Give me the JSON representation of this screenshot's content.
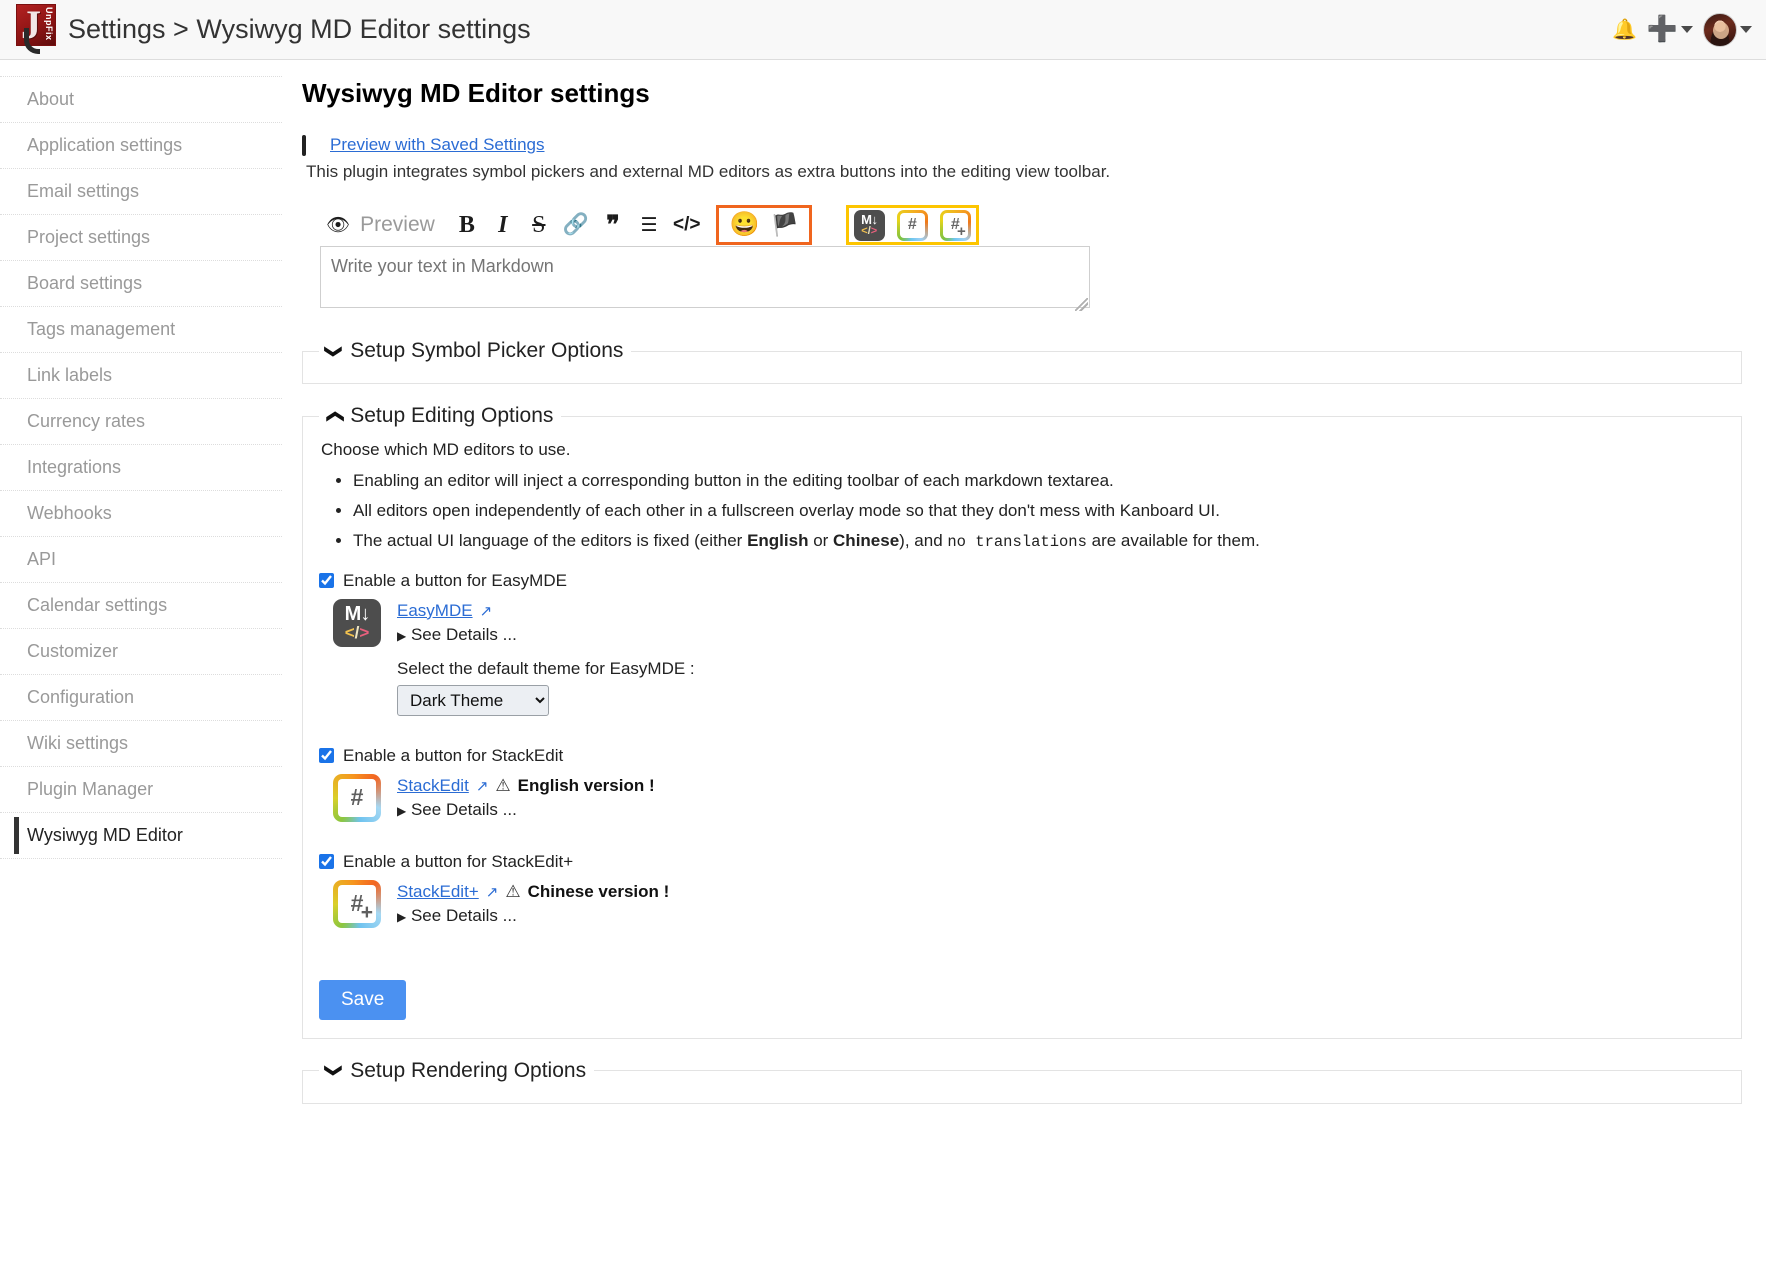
{
  "header": {
    "title": "Settings > Wysiwyg MD Editor settings",
    "logo_text": "UnpFix",
    "notifications_icon": "bell-icon",
    "add_icon": "plus-icon",
    "user_menu_caret": "chevron-down-icon"
  },
  "sidebar": {
    "items": [
      {
        "label": "About",
        "active": false
      },
      {
        "label": "Application settings",
        "active": false
      },
      {
        "label": "Email settings",
        "active": false
      },
      {
        "label": "Project settings",
        "active": false
      },
      {
        "label": "Board settings",
        "active": false
      },
      {
        "label": "Tags management",
        "active": false
      },
      {
        "label": "Link labels",
        "active": false
      },
      {
        "label": "Currency rates",
        "active": false
      },
      {
        "label": "Integrations",
        "active": false
      },
      {
        "label": "Webhooks",
        "active": false
      },
      {
        "label": "API",
        "active": false
      },
      {
        "label": "Calendar settings",
        "active": false
      },
      {
        "label": "Customizer",
        "active": false
      },
      {
        "label": "Configuration",
        "active": false
      },
      {
        "label": "Wiki settings",
        "active": false
      },
      {
        "label": "Plugin Manager",
        "active": false
      },
      {
        "label": "Wysiwyg MD Editor",
        "active": true
      }
    ]
  },
  "main": {
    "title": "Wysiwyg MD Editor settings",
    "preview_link": "Preview with Saved Settings",
    "intro": "This plugin integrates symbol pickers and external MD editors as extra buttons into the editing view toolbar.",
    "demo": {
      "preview_label": "Preview",
      "bold": "B",
      "italic": "I",
      "strike": "S",
      "link": "🔗",
      "quote": "❞",
      "list": "☰",
      "code": "</>",
      "emoji": "😀",
      "flag": "🏴",
      "easymde_top": "M",
      "easymde_arrow": "↓",
      "stackedit_glyph": "#",
      "stackeditplus_glyph": "#",
      "stackeditplus_plus": "+",
      "textarea_placeholder": "Write your text in Markdown",
      "textarea_value": "",
      "highlight_symbol_color": "#f0651e",
      "highlight_editor_color": "#fdc500"
    },
    "panels": {
      "symbol_picker": {
        "title": "Setup Symbol Picker Options",
        "collapsed": true,
        "chevron": "chevron-down-icon"
      },
      "editing": {
        "title": "Setup Editing Options",
        "collapsed": false,
        "chevron": "chevron-up-icon"
      },
      "rendering": {
        "title": "Setup Rendering Options",
        "collapsed": true,
        "chevron": "chevron-down-icon"
      }
    },
    "editing": {
      "choose_text": "Choose which MD editors to use.",
      "notes": [
        {
          "parts": [
            {
              "t": "Enabling an editor will inject a corresponding button in the editing toolbar of each markdown textarea.",
              "s": "n"
            }
          ]
        },
        {
          "parts": [
            {
              "t": "All editors open independently of each other in a fullscreen overlay mode so that they don't mess with Kanboard UI.",
              "s": "n"
            }
          ]
        },
        {
          "parts": [
            {
              "t": "The actual UI language of the editors is fixed (either ",
              "s": "n"
            },
            {
              "t": "English",
              "s": "b"
            },
            {
              "t": " or ",
              "s": "n"
            },
            {
              "t": "Chinese",
              "s": "b"
            },
            {
              "t": "), and ",
              "s": "n"
            },
            {
              "t": "no translations",
              "s": "m"
            },
            {
              "t": " are available for them.",
              "s": "n"
            }
          ]
        }
      ],
      "editors": [
        {
          "enable_label": "Enable a button for EasyMDE",
          "checked": true,
          "name": "EasyMDE",
          "external_icon": "external-link-icon",
          "warning": "",
          "version_note": "",
          "see_details": "See Details ...",
          "theme_label": "Select the default theme for EasyMDE :",
          "theme_value": "Dark Theme",
          "theme_options": [
            "Dark Theme"
          ]
        },
        {
          "enable_label": "Enable a button for StackEdit",
          "checked": true,
          "name": "StackEdit",
          "external_icon": "external-link-icon",
          "warning": "⚠",
          "version_note": "English version !",
          "see_details": "See Details ..."
        },
        {
          "enable_label": "Enable a button for StackEdit+",
          "checked": true,
          "name": "StackEdit+",
          "external_icon": "external-link-icon",
          "warning": "⚠",
          "version_note": "Chinese version !",
          "see_details": "See Details ..."
        }
      ],
      "save_label": "Save"
    }
  },
  "colors": {
    "link": "#2b6cd4",
    "save_button": "#4b91f1",
    "active_sidebar_bar": "#333333",
    "checkbox_accent": "#1a73e8"
  }
}
